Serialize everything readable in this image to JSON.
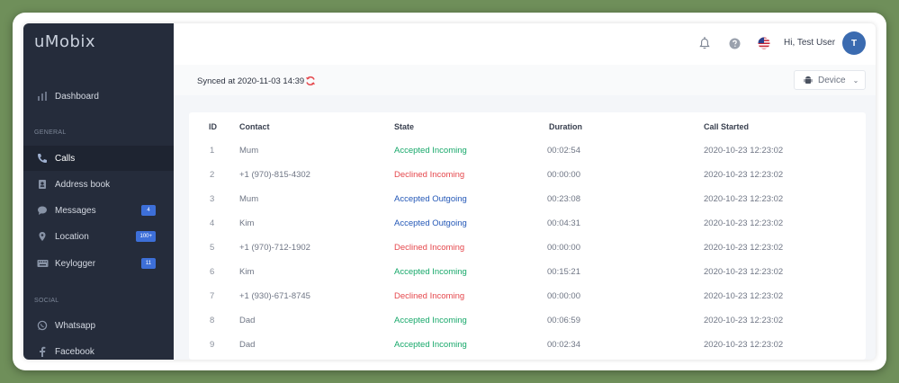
{
  "app": {
    "logo": "uMobix"
  },
  "sidebar": {
    "dashboard": "Dashboard",
    "general_label": "GENERAL",
    "items": [
      {
        "label": "Calls",
        "icon": "phone-icon",
        "badge": ""
      },
      {
        "label": "Address book",
        "icon": "contacts-icon",
        "badge": ""
      },
      {
        "label": "Messages",
        "icon": "chat-icon",
        "badge": "4"
      },
      {
        "label": "Location",
        "icon": "location-pin-icon",
        "badge": "100+"
      },
      {
        "label": "Keylogger",
        "icon": "keyboard-icon",
        "badge": "11"
      }
    ],
    "social_label": "SOCIAL",
    "social_items": [
      {
        "label": "Whatsapp",
        "icon": "whatsapp-icon"
      },
      {
        "label": "Facebook",
        "icon": "facebook-icon"
      }
    ]
  },
  "topbar": {
    "user_name": "Hi, Test User",
    "avatar_initial": "T"
  },
  "sync": {
    "text": "Synced at 2020-11-03 14:39",
    "device_label": "Device"
  },
  "table": {
    "columns": [
      "ID",
      "Contact",
      "State",
      "Duration",
      "Call Started"
    ],
    "rows": [
      {
        "id": "1",
        "contact": "Mum",
        "state": "Accepted Incoming",
        "duration": "00:02:54",
        "started": "2020-10-23 12:23:02"
      },
      {
        "id": "2",
        "contact": "+1 (970)-815-4302",
        "state": "Declined Incoming",
        "duration": "00:00:00",
        "started": "2020-10-23 12:23:02"
      },
      {
        "id": "3",
        "contact": "Mum",
        "state": "Accepted Outgoing",
        "duration": "00:23:08",
        "started": "2020-10-23 12:23:02"
      },
      {
        "id": "4",
        "contact": "Kim",
        "state": "Accepted Outgoing",
        "duration": "00:04:31",
        "started": "2020-10-23 12:23:02"
      },
      {
        "id": "5",
        "contact": "+1 (970)-712-1902",
        "state": "Declined Incoming",
        "duration": "00:00:00",
        "started": "2020-10-23 12:23:02"
      },
      {
        "id": "6",
        "contact": "Kim",
        "state": "Accepted Incoming",
        "duration": "00:15:21",
        "started": "2020-10-23 12:23:02"
      },
      {
        "id": "7",
        "contact": "+1 (930)-671-8745",
        "state": "Declined Incoming",
        "duration": "00:00:00",
        "started": "2020-10-23 12:23:02"
      },
      {
        "id": "8",
        "contact": "Dad",
        "state": "Accepted Incoming",
        "duration": "00:06:59",
        "started": "2020-10-23 12:23:02"
      },
      {
        "id": "9",
        "contact": "Dad",
        "state": "Accepted Incoming",
        "duration": "00:02:34",
        "started": "2020-10-23 12:23:02"
      }
    ]
  },
  "colors": {
    "accepted_incoming": "#17a86a",
    "declined": "#e5484d",
    "accepted_outgoing": "#2458b7",
    "sidebar_bg": "#252c3b",
    "badge": "#3d6fd8"
  }
}
